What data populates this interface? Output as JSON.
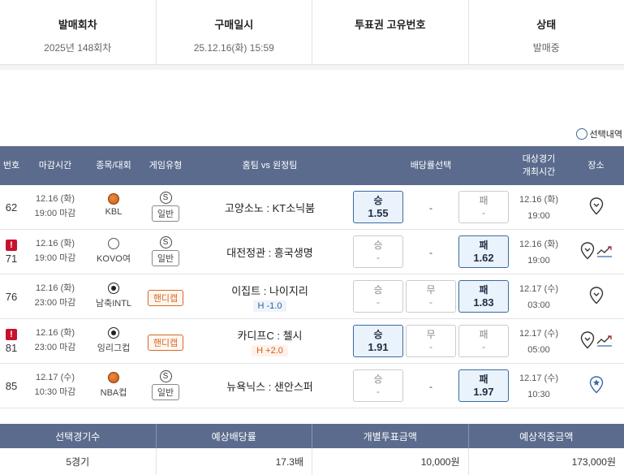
{
  "summary": {
    "round": {
      "label": "발매회차",
      "value": "2025년 148회차"
    },
    "purchase": {
      "label": "구매일시",
      "value": "25.12.16(화) 15:59"
    },
    "ticket_id": {
      "label": "투표권 고유번호",
      "value": ""
    },
    "status": {
      "label": "상태",
      "value": "발매중"
    }
  },
  "select_list_label": "선택내역",
  "table_header": {
    "no": "번호",
    "deadline": "마감시간",
    "sport": "종목/대회",
    "game_type": "게임유형",
    "match": "홈팀 vs 원정팀",
    "odds": "배당률선택",
    "game_time": "대상경기\n개최시간",
    "place": "장소"
  },
  "rows": [
    {
      "no": "62",
      "flag": false,
      "date": "12.16 (화)",
      "close": "19:00 마감",
      "league": "KBL",
      "sport_icon": "basketball-icon",
      "type_symbol": "S",
      "type": "일반",
      "handicap": false,
      "home": "고양소노",
      "away": "KT소닉붐",
      "sep": " : ",
      "hc": "",
      "win": {
        "label": "승",
        "value": "1.55",
        "selected": true
      },
      "draw": "-",
      "lose": {
        "label": "패",
        "value": "-",
        "selected": false
      },
      "game_date": "12.16 (화)",
      "game_time": "19:00",
      "place_icon": "location-icon",
      "trend": false
    },
    {
      "no": "71",
      "flag": true,
      "date": "12.16 (화)",
      "close": "19:00 마감",
      "league": "KOVO여",
      "sport_icon": "volleyball-icon",
      "type_symbol": "S",
      "type": "일반",
      "handicap": false,
      "home": "대전정관",
      "away": "흥국생명",
      "sep": " : ",
      "hc": "",
      "win": {
        "label": "승",
        "value": "-",
        "selected": false
      },
      "draw": "-",
      "lose": {
        "label": "패",
        "value": "1.62",
        "selected": true
      },
      "game_date": "12.16 (화)",
      "game_time": "19:00",
      "place_icon": "location-icon",
      "trend": true
    },
    {
      "no": "76",
      "flag": false,
      "date": "12.16 (화)",
      "close": "23:00 마감",
      "league": "남축INTL",
      "sport_icon": "soccer-ball-icon",
      "type_symbol": "",
      "type": "핸디캡",
      "handicap": true,
      "home": "이집트",
      "away": "나이지리",
      "sep": " : ",
      "hc": "H -1.0",
      "hc_class": "neg",
      "win": {
        "label": "승",
        "value": "-",
        "selected": false
      },
      "draw_box": {
        "label": "무",
        "value": "-"
      },
      "lose": {
        "label": "패",
        "value": "1.83",
        "selected": true
      },
      "game_date": "12.17 (수)",
      "game_time": "03:00",
      "place_icon": "location-icon",
      "trend": false
    },
    {
      "no": "81",
      "flag": true,
      "date": "12.16 (화)",
      "close": "23:00 마감",
      "league": "잉리그컵",
      "sport_icon": "soccer-ball-icon",
      "type_symbol": "",
      "type": "핸디캡",
      "handicap": true,
      "home": "카디프C",
      "away": "첼시",
      "sep": " : ",
      "hc": "H +2.0",
      "hc_class": "pos",
      "win": {
        "label": "승",
        "value": "1.91",
        "selected": true
      },
      "draw_box": {
        "label": "무",
        "value": "-"
      },
      "lose": {
        "label": "패",
        "value": "-",
        "selected": false
      },
      "game_date": "12.17 (수)",
      "game_time": "05:00",
      "place_icon": "location-icon",
      "trend": true
    },
    {
      "no": "85",
      "flag": false,
      "date": "12.17 (수)",
      "close": "10:30 마감",
      "league": "NBA컵",
      "sport_icon": "basketball-icon",
      "type_symbol": "S",
      "type": "일반",
      "handicap": false,
      "home": "뉴욕닉스",
      "away": "샌안스퍼",
      "sep": " : ",
      "hc": "",
      "win": {
        "label": "승",
        "value": "-",
        "selected": false
      },
      "draw": "-",
      "lose": {
        "label": "패",
        "value": "1.97",
        "selected": true
      },
      "game_date": "12.17 (수)",
      "game_time": "10:30",
      "place_icon": "location-star-icon",
      "trend": false
    }
  ],
  "footer": {
    "headers": [
      "선택경기수",
      "예상배당률",
      "개별투표금액",
      "예상적중금액"
    ],
    "values": [
      "5경기",
      "17.3배",
      "10,000원",
      "173,000원"
    ]
  },
  "colors": {
    "header_bg": "#5b6b8d",
    "selected_bg": "#eaf2fc",
    "selected_border": "#3b6aa0",
    "warn": "#c8102e",
    "handicap": "#d16a2a"
  }
}
